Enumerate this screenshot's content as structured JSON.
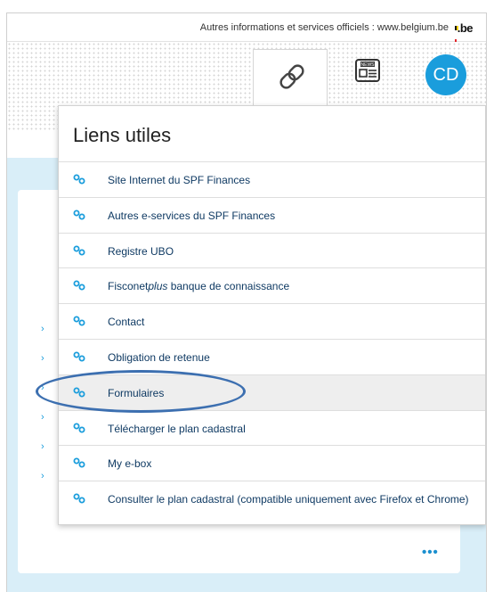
{
  "topbar": {
    "text": "Autres informations et services officiels : www.belgium.be",
    "logo": ".be"
  },
  "header": {
    "tab_icon": "link-icon",
    "news_icon": "newspaper-icon",
    "news_label": "NEWS",
    "avatar_initials": "CD"
  },
  "dropdown": {
    "title": "Liens utiles",
    "items": [
      {
        "label": "Site Internet du SPF Finances"
      },
      {
        "label": "Autres e-services du SPF Finances"
      },
      {
        "label": "Registre UBO"
      },
      {
        "label_prefix": "Fisconet",
        "label_italic": "plus",
        "label_suffix": " banque de connaissance"
      },
      {
        "label": "Contact"
      },
      {
        "label": "Obligation de retenue"
      },
      {
        "label": "Formulaires"
      },
      {
        "label": "Télécharger le plan cadastral"
      },
      {
        "label": "My e-box"
      },
      {
        "label": "Consulter le plan cadastral (compatible uniquement avec Firefox et Chrome)"
      }
    ]
  },
  "card": {
    "more": "•••",
    "chevron": "›"
  },
  "colors": {
    "accent": "#1a9ddc",
    "link_text": "#0f3a63",
    "content_bg": "#d9eef8",
    "highlight_ellipse": "#3c6fb0"
  }
}
